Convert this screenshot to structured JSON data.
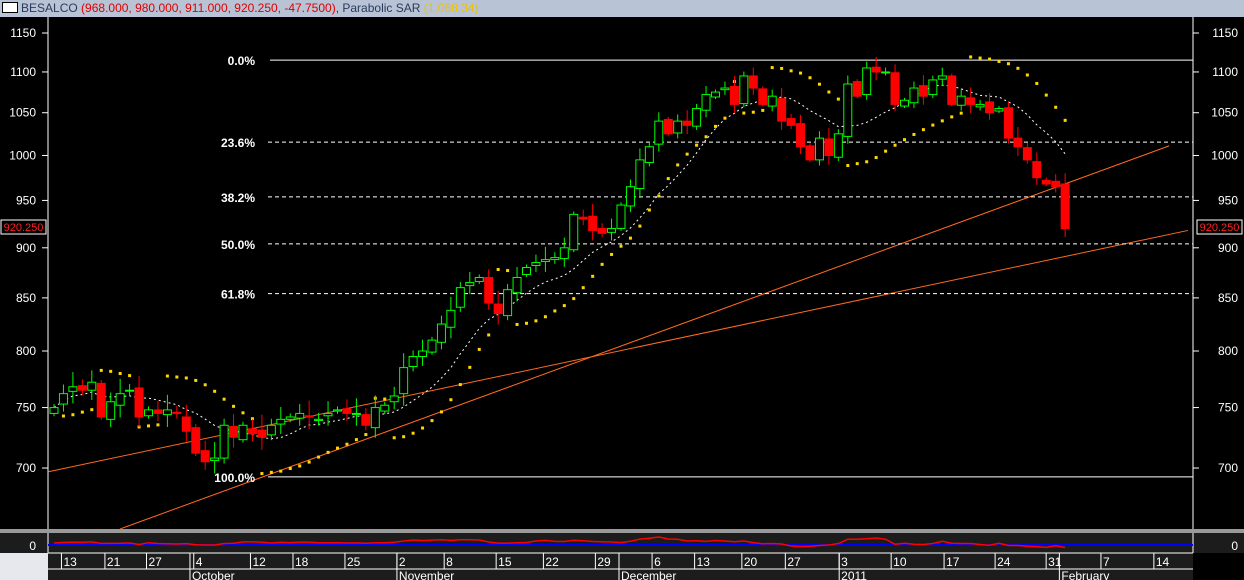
{
  "title": {
    "symbol": "BESALCO",
    "ohlc_text": "(968.000, 980.000, 911.000, 920.250, -47.7500)",
    "indicator_name": "Parabolic SAR",
    "indicator_value": "(1,088.34)"
  },
  "price_label": "920.250",
  "oscillator_zero_label": "0",
  "colors": {
    "up": "#00ff00",
    "down": "#ff0000",
    "sar": "#ffd700",
    "ma": "#ffffff",
    "trend": "#ff6a20",
    "fib": "#ffffff"
  },
  "chart_data": {
    "type": "candlestick",
    "scale": "log",
    "ylim": [
      640,
      1170
    ],
    "y_ticks": [
      "1150",
      "1100",
      "1050",
      "1000",
      "950",
      "900",
      "850",
      "800",
      "750",
      "700"
    ],
    "y_tick_values": [
      1150,
      1100,
      1050,
      1000,
      950,
      900,
      850,
      800,
      750,
      700
    ],
    "closes": [
      750,
      762,
      768,
      765,
      772,
      742,
      755,
      762,
      765,
      742,
      748,
      745,
      748,
      745,
      730,
      712,
      705,
      708,
      735,
      725,
      735,
      728,
      725,
      735,
      740,
      742,
      745,
      742,
      740,
      745,
      748,
      745,
      745,
      735,
      750,
      752,
      760,
      785,
      795,
      800,
      810,
      825,
      838,
      860,
      865,
      870,
      845,
      835,
      858,
      870,
      880,
      885,
      888,
      890,
      900,
      935,
      930,
      918,
      915,
      920,
      945,
      965,
      995,
      1010,
      1040,
      1025,
      1040,
      1035,
      1055,
      1072,
      1075,
      1080,
      1060,
      1095,
      1080,
      1060,
      1070,
      1040,
      1035,
      1010,
      995,
      1020,
      1000,
      1025,
      1085,
      1070,
      1105,
      1100,
      1100,
      1060,
      1065,
      1080,
      1070,
      1090,
      1095,
      1060,
      1070,
      1060,
      1060,
      1050,
      1055,
      1020,
      1010,
      995,
      975,
      968,
      965,
      920
    ],
    "last_candle": {
      "open": 968.0,
      "high": 980.0,
      "low": 911.0,
      "close": 920.25,
      "change": -47.75
    },
    "fibonacci": [
      {
        "label": "0.0%",
        "price": 1115
      },
      {
        "label": "23.6%",
        "price": 1015.4
      },
      {
        "label": "38.2%",
        "price": 953.8
      },
      {
        "label": "50.0%",
        "price": 904
      },
      {
        "label": "61.8%",
        "price": 854.2
      },
      {
        "label": "100.0%",
        "price": 693
      }
    ],
    "trendlines": [
      {
        "from": {
          "index": -0.6,
          "price": 697
        },
        "to": {
          "index": 120,
          "price": 918
        }
      },
      {
        "from": {
          "index": 7,
          "price": 653
        },
        "to": {
          "index": 118,
          "price": 1011
        }
      }
    ],
    "moving_average_period": 10,
    "sar": {
      "step": 0.02,
      "max": 0.2
    },
    "date_ticks": [
      {
        "label": "13",
        "index": 1
      },
      {
        "label": "21",
        "index": 5.6
      },
      {
        "label": "27",
        "index": 10
      },
      {
        "label": "4",
        "index": 15
      },
      {
        "label": "12",
        "index": 21
      },
      {
        "label": "18",
        "index": 25.5
      },
      {
        "label": "25",
        "index": 31
      },
      {
        "label": "2",
        "index": 36.5
      },
      {
        "label": "8",
        "index": 41.5
      },
      {
        "label": "15",
        "index": 47
      },
      {
        "label": "22",
        "index": 52
      },
      {
        "label": "29",
        "index": 57.5
      },
      {
        "label": "6",
        "index": 63.5
      },
      {
        "label": "13",
        "index": 68
      },
      {
        "label": "20",
        "index": 73
      },
      {
        "label": "27",
        "index": 77.6
      },
      {
        "label": "3",
        "index": 83.3
      },
      {
        "label": "10",
        "index": 88.8
      },
      {
        "label": "17",
        "index": 94.4
      },
      {
        "label": "24",
        "index": 99.8
      },
      {
        "label": "31",
        "index": 105.2
      },
      {
        "label": "7",
        "index": 111
      },
      {
        "label": "14",
        "index": 116.6
      }
    ],
    "month_ticks": [
      {
        "label": "October",
        "index": 14.6
      },
      {
        "label": "November",
        "index": 36.5
      },
      {
        "label": "December",
        "index": 60
      },
      {
        "label": "2011",
        "index": 83.3
      },
      {
        "label": "February",
        "index": 106.6
      }
    ]
  }
}
